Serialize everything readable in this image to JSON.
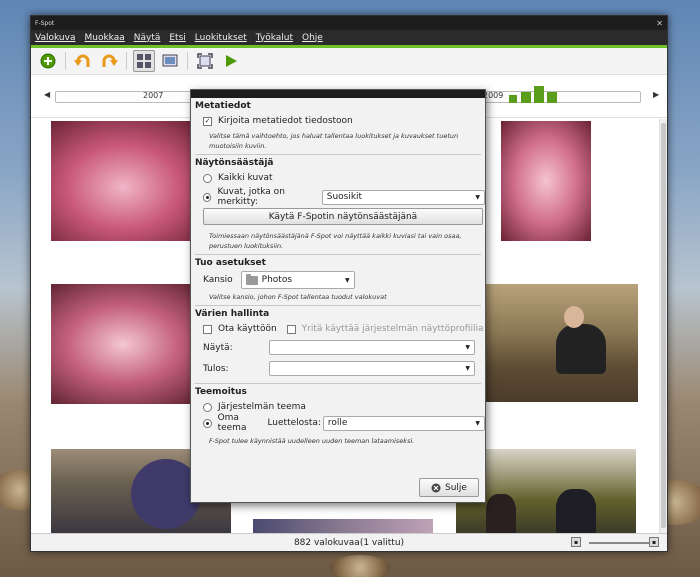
{
  "window": {
    "title": "F-Spot"
  },
  "menu": [
    "Valokuva",
    "Muokkaa",
    "Näytä",
    "Etsi",
    "Luokitukset",
    "Työkalut",
    "Ohje"
  ],
  "toolbar": [
    "add-icon",
    "rotate-left-icon",
    "rotate-right-icon",
    "browse-icon",
    "edit-image-icon",
    "fullscreen-icon",
    "slideshow-icon"
  ],
  "timeline": {
    "year_left": "2007",
    "year_right": "2009"
  },
  "status": {
    "text": "882 valokuvaa(1 valittu)"
  },
  "dialog": {
    "metadata": {
      "heading": "Metatiedot",
      "write_label": "Kirjoita metatiedot tiedostoon",
      "hint": "Valitse tämä vaihtoehto, jos haluat tallentaa luokitukset ja kuvaukset tuetun muotoisiin kuviin."
    },
    "screensaver": {
      "heading": "Näytönsäästäjä",
      "all_label": "Kaikki kuvat",
      "tagged_label": "Kuvat, jotka on merkitty:",
      "tag_value": "Suosikit",
      "use_button": "Käytä F-Spotin näytönsäästäjänä",
      "hint": "Toimiessaan näytönsäästäjänä F-Spot voi näyttää kaikki kuviasi tai vain osaa, perustuen luokituksiin."
    },
    "import": {
      "heading": "Tuo asetukset",
      "folder_label": "Kansio",
      "folder_value": "Photos",
      "hint": "Valitse kansio, johon F-Spot tallentaa tuodut valokuvat"
    },
    "color": {
      "heading": "Värien hallinta",
      "enable_label": "Ota käyttöön",
      "system_label": "Yritä käyttää järjestelmän näyttöprofiilia",
      "display_label": "Näytä:",
      "output_label": "Tulos:"
    },
    "theme": {
      "heading": "Teemoitus",
      "system_label": "Järjestelmän teema",
      "custom_label": "Oma teema",
      "from_list_label": "Luettelosta:",
      "theme_value": "rolle",
      "hint": "F-Spot tulee käynnistää uudelleen uuden teeman lataamiseksi."
    },
    "close_button": "Sulje"
  }
}
